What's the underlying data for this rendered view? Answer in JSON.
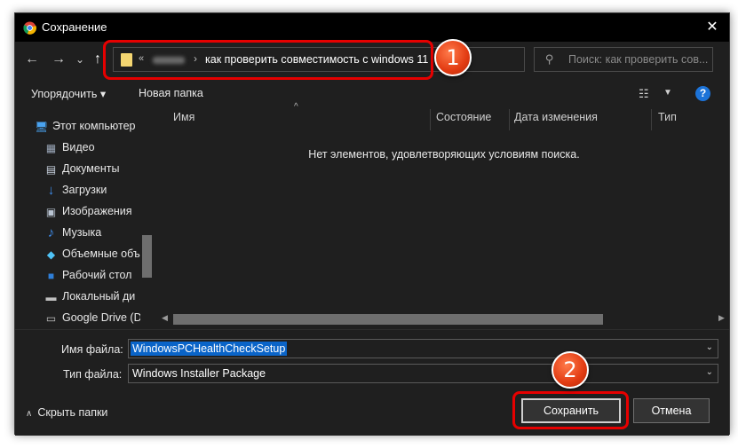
{
  "window": {
    "title": "Сохранение",
    "close_glyph": "✕"
  },
  "nav": {
    "back_glyph": "←",
    "forward_glyph": "→",
    "recent_glyph": "⌄",
    "up_glyph": "↑",
    "crumb_prefix": "«",
    "crumb_sep": "›",
    "current_folder": "как проверить совместимость с windows 11",
    "dropdown_glyph": "⌄",
    "refresh_glyph": "↻"
  },
  "search": {
    "placeholder": "Поиск: как проверить сов..."
  },
  "toolbar": {
    "organize_label": "Упорядочить ▾",
    "new_folder_label": "Новая папка",
    "view_glyph": "☷",
    "view_caret": "▼",
    "help_glyph": "?"
  },
  "navpane": {
    "items": [
      {
        "label": "Этот компьютер",
        "icon": "monitor-icon",
        "glyph": "🖥",
        "color": "#4aa3f0"
      },
      {
        "label": "Видео",
        "icon": "video-icon",
        "glyph": "▦",
        "color": "#9aa6b8"
      },
      {
        "label": "Документы",
        "icon": "document-icon",
        "glyph": "▤",
        "color": "#c9d3e0"
      },
      {
        "label": "Загрузки",
        "icon": "download-icon",
        "glyph": "↓",
        "color": "#3f8ff0"
      },
      {
        "label": "Изображения",
        "icon": "image-icon",
        "glyph": "▣",
        "color": "#b9c4d2"
      },
      {
        "label": "Музыка",
        "icon": "music-icon",
        "glyph": "♪",
        "color": "#3f8ff0"
      },
      {
        "label": "Объемные объ",
        "icon": "3d-objects-icon",
        "glyph": "◆",
        "color": "#4fc3f7"
      },
      {
        "label": "Рабочий стол",
        "icon": "desktop-icon",
        "glyph": "■",
        "color": "#2f7fd8"
      },
      {
        "label": "Локальный ди",
        "icon": "local-disk-icon",
        "glyph": "▬",
        "color": "#c0c0c0"
      },
      {
        "label": "Google Drive (D",
        "icon": "drive-icon",
        "glyph": "▭",
        "color": "#c0c0c0"
      }
    ]
  },
  "filelist": {
    "columns": [
      {
        "label": "Имя"
      },
      {
        "label": "Состояние"
      },
      {
        "label": "Дата изменения"
      },
      {
        "label": "Тип"
      }
    ],
    "sort_glyph": "^",
    "empty_message": "Нет элементов, удовлетворяющих условиям поиска."
  },
  "fields": {
    "filename_label": "Имя файла:",
    "filename_value": "WindowsPCHealthCheckSetup",
    "filetype_label": "Тип файла:",
    "filetype_value": "Windows Installer Package",
    "caret_glyph": "⌄"
  },
  "footer": {
    "hide_folders_caret": "∧",
    "hide_folders_label": "Скрыть папки",
    "save_label": "Сохранить",
    "cancel_label": "Отмена"
  },
  "callouts": {
    "badge_1": "1",
    "badge_2": "2"
  },
  "colors": {
    "accent_red": "#e60000",
    "selection_blue": "#0a64c8",
    "help_blue": "#1c73d8"
  }
}
